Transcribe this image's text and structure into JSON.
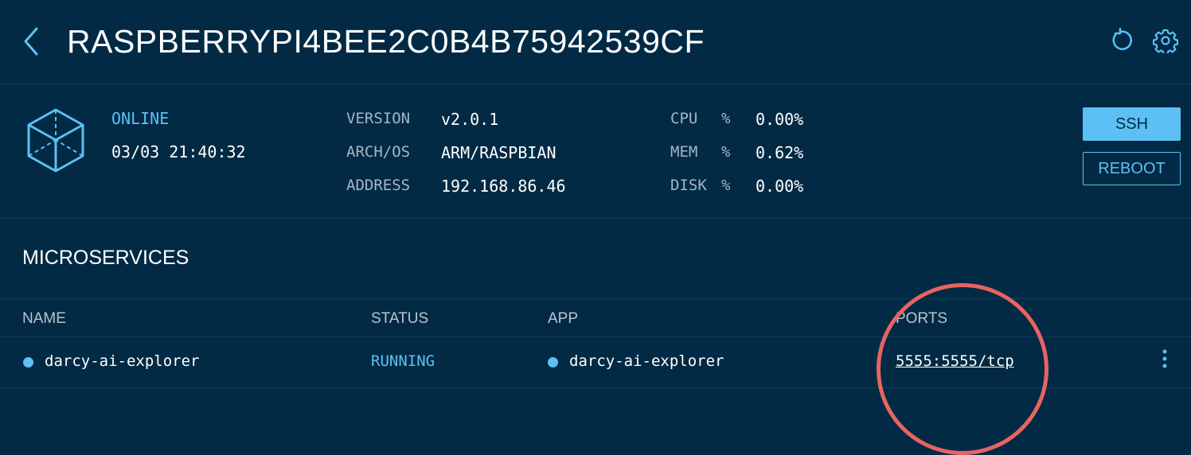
{
  "header": {
    "title": "RASPBERRYPI4BEE2C0B4B75942539CF",
    "icons": {
      "back": "chevron-left-icon",
      "refresh": "refresh-icon",
      "settings": "gear-icon"
    }
  },
  "agent": {
    "icon": "cube-icon",
    "status": "ONLINE",
    "last_seen": "03/03 21:40:32",
    "details": [
      {
        "label": "VERSION",
        "value": "v2.0.1"
      },
      {
        "label": "ARCH/OS",
        "value": "ARM/RASPBIAN"
      },
      {
        "label": "ADDRESS",
        "value": "192.168.86.46"
      }
    ],
    "usage": [
      {
        "label": "CPU",
        "unit": "%",
        "value": "0.00%"
      },
      {
        "label": "MEM",
        "unit": "%",
        "value": "0.62%"
      },
      {
        "label": "DISK",
        "unit": "%",
        "value": "0.00%"
      }
    ],
    "actions": {
      "ssh": "SSH",
      "reboot": "REBOOT"
    }
  },
  "microservices": {
    "title": "MICROSERVICES",
    "columns": {
      "name": "NAME",
      "status": "STATUS",
      "app": "APP",
      "ports": "PORTS"
    },
    "rows": [
      {
        "name": "darcy-ai-explorer",
        "status": "RUNNING",
        "app": "darcy-ai-explorer",
        "ports": "5555:5555/tcp"
      }
    ]
  },
  "colors": {
    "background": "#022a44",
    "accent": "#5dc0f5",
    "highlight": "#e86361"
  }
}
